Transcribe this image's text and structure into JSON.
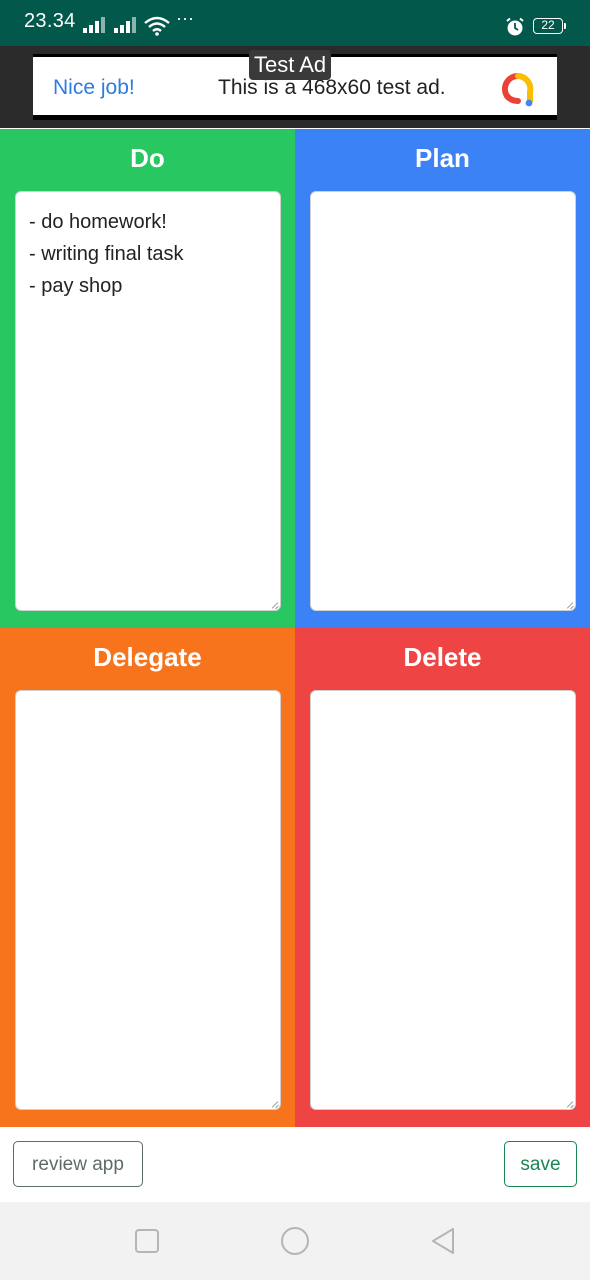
{
  "status": {
    "time": "23.34",
    "more": "···",
    "battery": "22"
  },
  "ad": {
    "label": "Test Ad",
    "headline": "Nice job!",
    "body": "This is a 468x60 test ad."
  },
  "quadrants": [
    {
      "title": "Do",
      "color": "#28c762",
      "content": "- do homework!\n- writing final task\n- pay shop"
    },
    {
      "title": "Plan",
      "color": "#3b82f6",
      "content": ""
    },
    {
      "title": "Delegate",
      "color": "#f7731c",
      "content": ""
    },
    {
      "title": "Delete",
      "color": "#ef4444",
      "content": ""
    }
  ],
  "buttons": {
    "review": "review app",
    "save": "save"
  },
  "nav": {
    "icons": [
      "recents-square-icon",
      "home-circle-icon",
      "back-triangle-icon"
    ]
  }
}
